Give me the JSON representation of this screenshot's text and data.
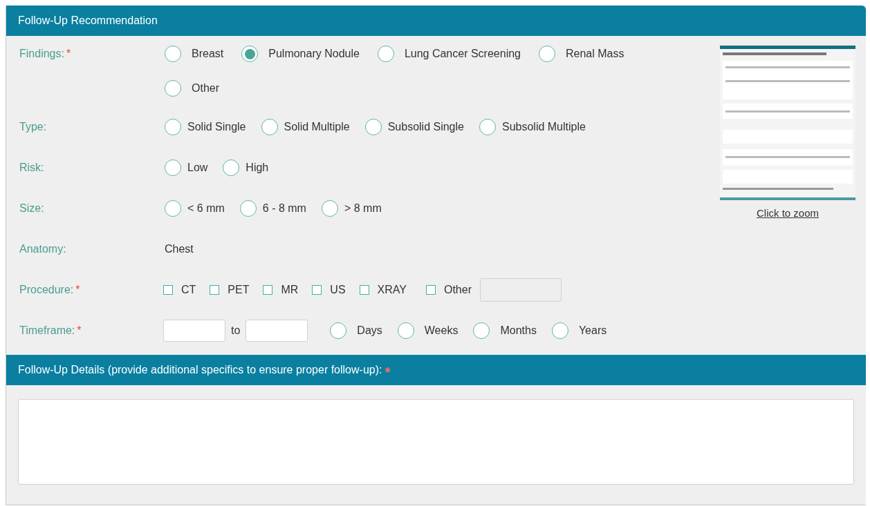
{
  "title": "Follow-Up Recommendation",
  "fields": [
    {
      "kind": "radio",
      "label": "Findings:",
      "required_mark": "*",
      "options": [
        {
          "label": "Breast",
          "selected": false
        },
        {
          "label": "Pulmonary Nodule",
          "selected": true
        },
        {
          "label": "Lung Cancer Screening",
          "selected": false
        },
        {
          "label": "Renal Mass",
          "selected": false
        },
        {
          "label": "Other",
          "selected": false
        }
      ]
    },
    {
      "kind": "radio",
      "label": "Type:",
      "options": [
        {
          "label": "Solid Single",
          "selected": false
        },
        {
          "label": "Solid Multiple",
          "selected": false
        },
        {
          "label": "Subsolid Single",
          "selected": false
        },
        {
          "label": "Subsolid Multiple",
          "selected": false
        }
      ]
    },
    {
      "kind": "radio",
      "label": "Risk:",
      "options": [
        {
          "label": "Low",
          "selected": false
        },
        {
          "label": "High",
          "selected": false
        }
      ]
    },
    {
      "kind": "radio",
      "label": "Size:",
      "options": [
        {
          "label": "< 6 mm",
          "selected": false
        },
        {
          "label": "6 - 8 mm",
          "selected": false
        },
        {
          "label": "> 8 mm",
          "selected": false
        }
      ]
    },
    {
      "kind": "text",
      "label": "Anatomy:",
      "value": "Chest"
    },
    {
      "kind": "checkbox",
      "label": "Procedure:",
      "required_mark": "*",
      "options": [
        {
          "label": "CT",
          "checked": false
        },
        {
          "label": "PET",
          "checked": false
        },
        {
          "label": "MR",
          "checked": false
        },
        {
          "label": "US",
          "checked": false
        },
        {
          "label": "XRAY",
          "checked": false
        },
        {
          "label": "Other",
          "checked": false
        }
      ],
      "has_text_field": true
    },
    {
      "kind": "range",
      "label": "Timeframe:",
      "required_mark": "*",
      "between": "to",
      "options": [
        {
          "label": "Days",
          "selected": false
        },
        {
          "label": "Weeks",
          "selected": false
        },
        {
          "label": "Months",
          "selected": false
        },
        {
          "label": "Years",
          "selected": false
        }
      ]
    }
  ],
  "thumbnail": {
    "link": "Click to zoom"
  },
  "details": {
    "title": "Follow-Up Details (provide additional specifics to ensure proper follow-up):",
    "required_mark": "✱"
  }
}
